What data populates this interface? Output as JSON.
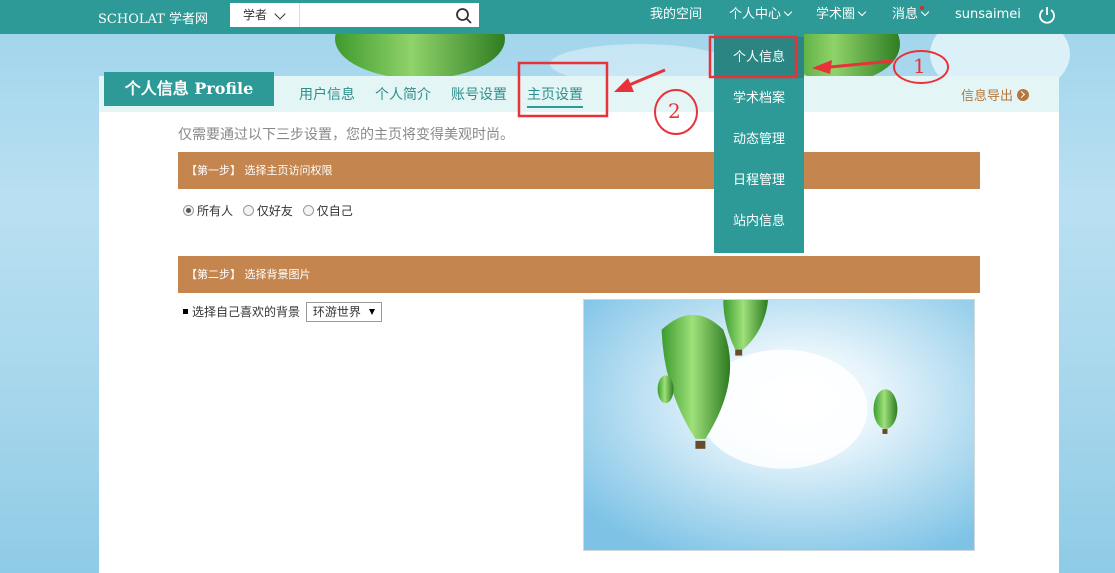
{
  "topbar": {
    "brand": "SCHOLAT 学者网",
    "search_type": "学者",
    "search_placeholder": "",
    "nav": {
      "my_space": "我的空间",
      "personal_center": "个人中心",
      "academic_circle": "学术圈",
      "messages": "消息",
      "username": "sunsaimei"
    }
  },
  "dropdown": {
    "items": [
      "个人信息",
      "学术档案",
      "动态管理",
      "日程管理",
      "站内信息"
    ]
  },
  "panel": {
    "profile_tag": "个人信息 Profile",
    "tabs": [
      "用户信息",
      "个人简介",
      "账号设置",
      "主页设置"
    ],
    "export": "信息导出",
    "intro": "仅需要通过以下三步设置，您的主页将变得美观时尚。",
    "step1": "【第一步】 选择主页访问权限",
    "radios": [
      "所有人",
      "仅好友",
      "仅自己"
    ],
    "step2": "【第二步】 选择背景图片",
    "bg_label": "选择自己喜欢的背景",
    "bg_selected": "环游世界"
  },
  "annotations": {
    "marker_1": "1",
    "marker_2": "2",
    "color": "#e8323a"
  },
  "colors": {
    "teal": "#2e9a98",
    "step_bar": "#c4854f",
    "export_text": "#b7773c"
  }
}
